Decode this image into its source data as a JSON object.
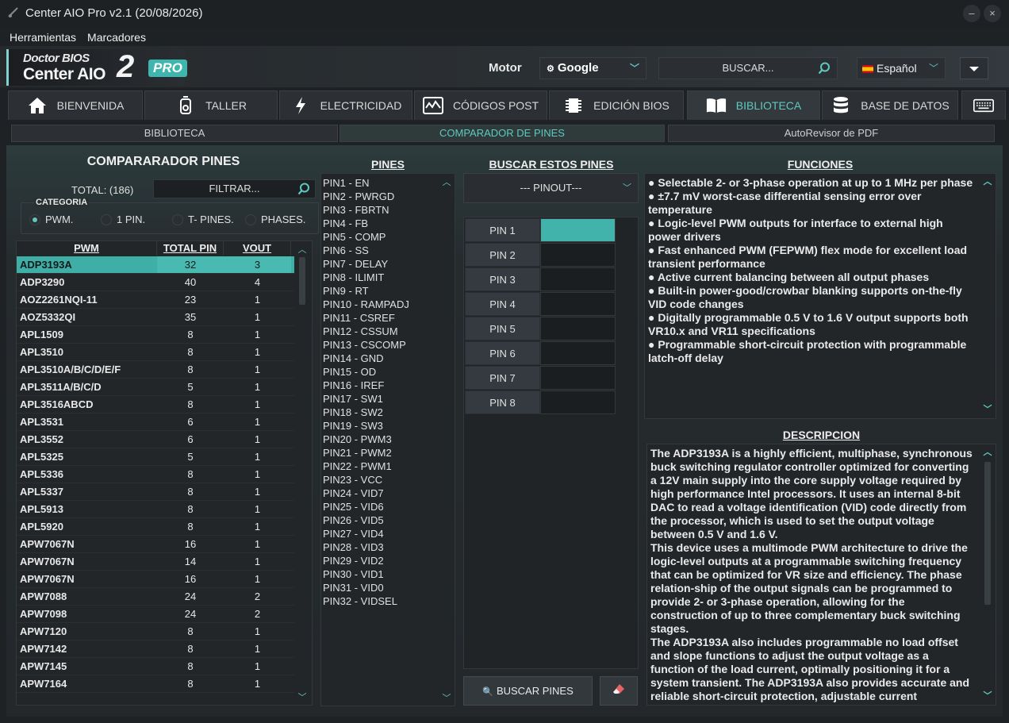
{
  "window": {
    "title": "Center AIO Pro v2.1 (20/08/2026)"
  },
  "menu": [
    "Herramientas",
    "Marcadores"
  ],
  "logo": {
    "line1": "Doctor BIOS",
    "line2": "Center AIO",
    "number": "2",
    "badge": "PRO"
  },
  "header": {
    "engine_label": "Motor",
    "engine_value": "Google",
    "search_placeholder": "BUSCAR...",
    "language": "Español"
  },
  "tabs": [
    {
      "label": "BIENVENIDA",
      "icon": "home-icon"
    },
    {
      "label": "TALLER",
      "icon": "multimeter-icon"
    },
    {
      "label": "ELECTRICIDAD",
      "icon": "lightning-icon"
    },
    {
      "label": "CÓDIGOS POST",
      "icon": "post-card-icon"
    },
    {
      "label": "EDICIÓN BIOS",
      "icon": "chip-icon"
    },
    {
      "label": "BIBLIOTECA",
      "icon": "book-icon",
      "active": true
    },
    {
      "label": "BASE DE DATOS",
      "icon": "database-icon"
    }
  ],
  "subtabs": [
    "BIBLIOTECA",
    "COMPARADOR DE PINES",
    "AutoRevisor de PDF"
  ],
  "left": {
    "title": "COMPARARADOR PINES",
    "total": "TOTAL: (186)",
    "filter_placeholder": "FILTRAR...",
    "category_label": "CATEGORIA",
    "categories": [
      "PWM.",
      "1 PIN.",
      "T- PINES.",
      "PHASES."
    ],
    "selected_category": 0,
    "columns": [
      "PWM",
      "TOTAL PIN",
      "VOUT"
    ],
    "rows": [
      [
        "ADP3193A",
        "32",
        "3"
      ],
      [
        "ADP3290",
        "40",
        "4"
      ],
      [
        "AOZ2261NQI-11",
        "23",
        "1"
      ],
      [
        "AOZ5332QI",
        "35",
        "1"
      ],
      [
        "APL1509",
        "8",
        "1"
      ],
      [
        "APL3510",
        "8",
        "1"
      ],
      [
        "APL3510A/B/C/D/E/F",
        "8",
        "1"
      ],
      [
        "APL3511A/B/C/D",
        "5",
        "1"
      ],
      [
        "APL3516ABCD",
        "8",
        "1"
      ],
      [
        "APL3531",
        "6",
        "1"
      ],
      [
        "APL3552",
        "6",
        "1"
      ],
      [
        "APL5325",
        "5",
        "1"
      ],
      [
        "APL5336",
        "8",
        "1"
      ],
      [
        "APL5337",
        "8",
        "1"
      ],
      [
        "APL5913",
        "8",
        "1"
      ],
      [
        "APL5920",
        "8",
        "1"
      ],
      [
        "APW7067N",
        "16",
        "1"
      ],
      [
        "APW7067N",
        "14",
        "1"
      ],
      [
        "APW7067N",
        "16",
        "1"
      ],
      [
        "APW7088",
        "24",
        "2"
      ],
      [
        "APW7098",
        "24",
        "2"
      ],
      [
        "APW7120",
        "8",
        "1"
      ],
      [
        "APW7142",
        "8",
        "1"
      ],
      [
        "APW7145",
        "8",
        "1"
      ],
      [
        "APW7164",
        "8",
        "1"
      ]
    ]
  },
  "pins": {
    "title": "PINES",
    "items": [
      "PIN1 - EN",
      "PIN2 - PWRGD",
      "PIN3 - FBRTN",
      "PIN4 - FB",
      "PIN5 - COMP",
      "PIN6 - SS",
      "PIN7 - DELAY",
      "PIN8 - ILIMIT",
      "PIN9 - RT",
      "PIN10 - RAMPADJ",
      "PIN11 - CSREF",
      "PIN12 - CSSUM",
      "PIN13 - CSCOMP",
      "PIN14 - GND",
      "PIN15 - OD",
      "PIN16 - IREF",
      "PIN17 - SW1",
      "PIN18 - SW2",
      "PIN19 - SW3",
      "PIN20 - PWM3",
      "PIN21 - PWM2",
      "PIN22 - PWM1",
      "PIN23 - VCC",
      "PIN24 - VID7",
      "PIN25 - VID6",
      "PIN26 - VID5",
      "PIN27 - VID4",
      "PIN28 - VID3",
      "PIN29 - VID2",
      "PIN30 - VID1",
      "PIN31 - VID0",
      "PIN32 - VIDSEL"
    ]
  },
  "search_pins": {
    "title": "BUSCAR ESTOS PINES",
    "pinout": "--- PINOUT---",
    "slots": [
      "PIN 1",
      "PIN 2",
      "PIN 3",
      "PIN 4",
      "PIN 5",
      "PIN 6",
      "PIN 7",
      "PIN 8"
    ],
    "search_button": "BUSCAR PINES"
  },
  "functions": {
    "title": "FUNCIONES",
    "lines": [
      "● Selectable 2- or 3-phase operation at up to 1 MHz per phase",
      "● ±7.7 mV worst-case differential sensing error over temperature",
      "● Logic-level PWM outputs for interface to external high power drivers",
      "● Fast enhanced PWM (FEPWM) flex mode for excellent load transient performance",
      "● Active current balancing between all output phases",
      "● Built-in power-good/crowbar blanking supports on-the-fly VID code changes",
      "● Digitally programmable 0.5 V to 1.6 V output supports both VR10.x and VR11 specifications",
      "● Programmable short-circuit protection with programmable latch-off delay"
    ]
  },
  "description": {
    "title": "DESCRIPCION",
    "paragraphs": [
      "The ADP3193A is a highly efficient, multiphase, synchronous buck switching regulator controller optimized for converting a 12V main supply into the core supply voltage required by high performance Intel processors. It uses an internal 8-bit DAC to read a voltage identification (VID) code directly from the processor, which is used to set the output voltage between 0.5 V and 1.6 V.",
      "This device uses a multimode PWM architecture to drive the logic-level outputs at a programmable switching frequency that can be optimized for VR size and efficiency. The phase relation-ship of the output signals can be programmed to provide 2- or 3-phase operation, allowing for the construction of up to three complementary buck switching stages.",
      "The ADP3193A also includes programmable no load offset and slope functions to adjust the output voltage as a function of the load current, optimally positioning it for a system transient. The ADP3193A also provides accurate and reliable short-circuit protection, adjustable current"
    ]
  },
  "colors": {
    "accent": "#5fc9c0",
    "selected_row": "#3eaea6",
    "background": "#1f2225"
  }
}
